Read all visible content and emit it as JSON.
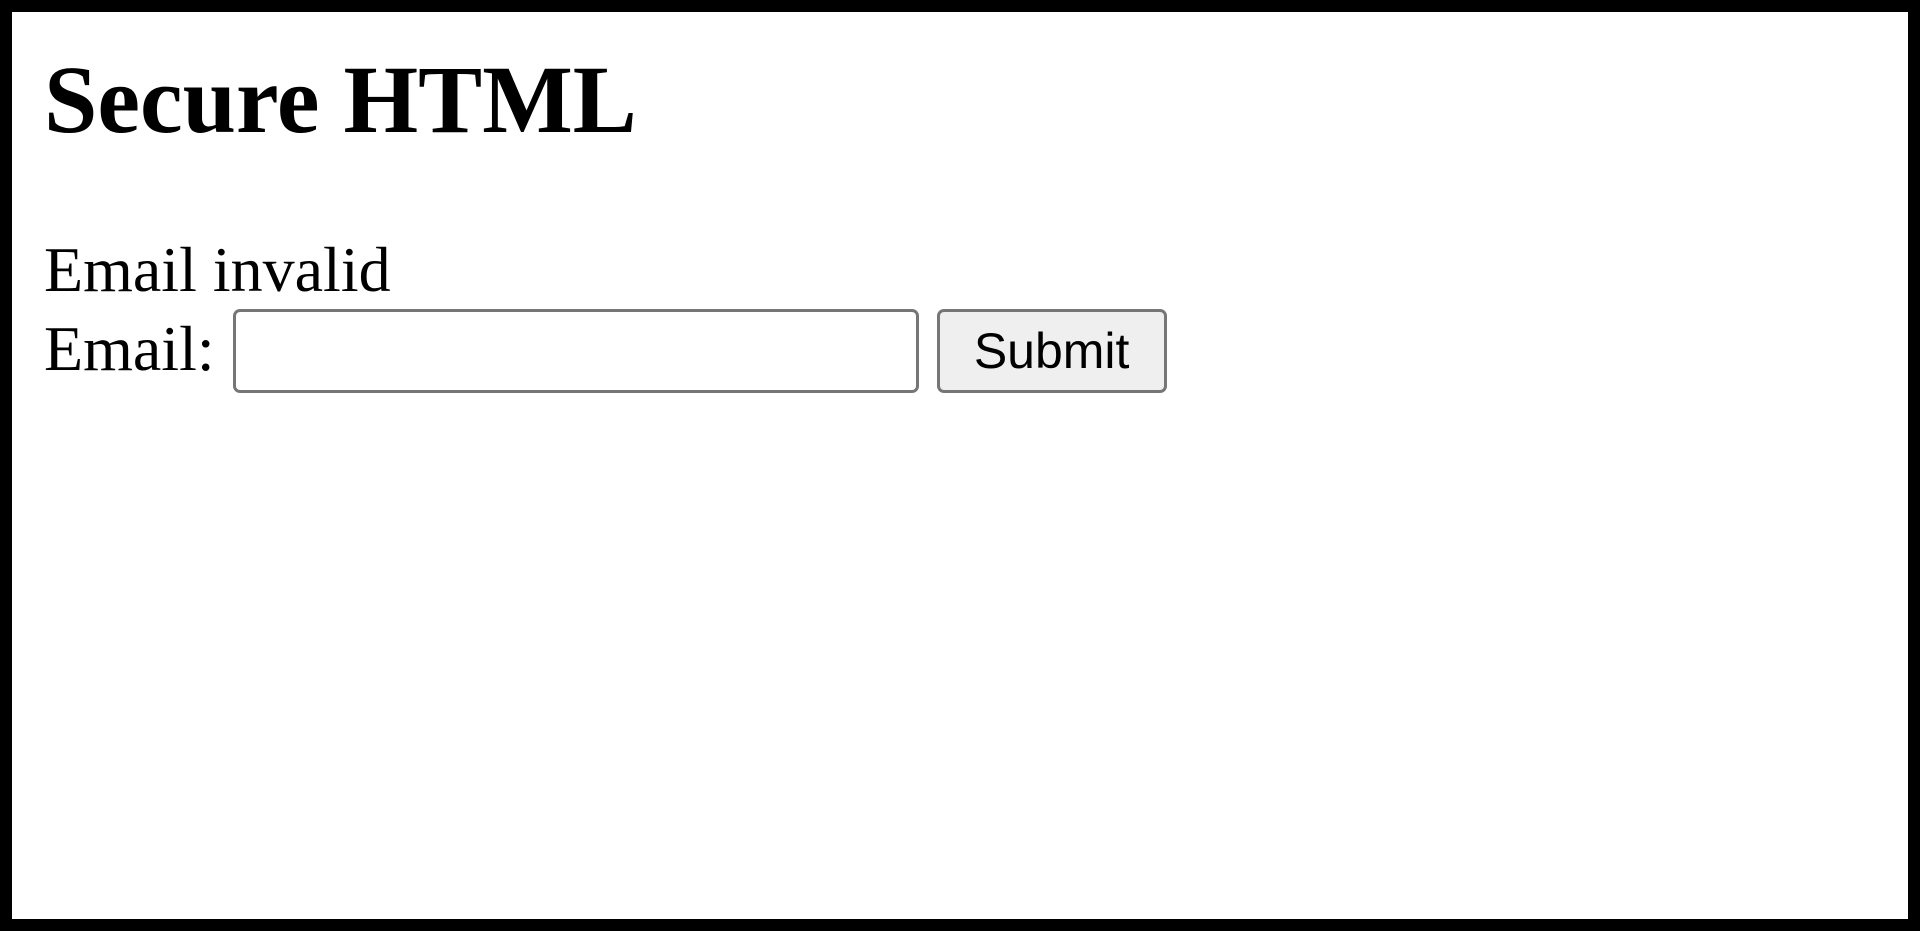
{
  "page": {
    "title": "Secure HTML",
    "error_message": "Email invalid"
  },
  "form": {
    "email_label": "Email:",
    "email_value": "",
    "submit_label": "Submit"
  },
  "colors": {
    "frame": "#000000",
    "background": "#ffffff",
    "input_border": "#767676",
    "button_background": "#efefef"
  }
}
